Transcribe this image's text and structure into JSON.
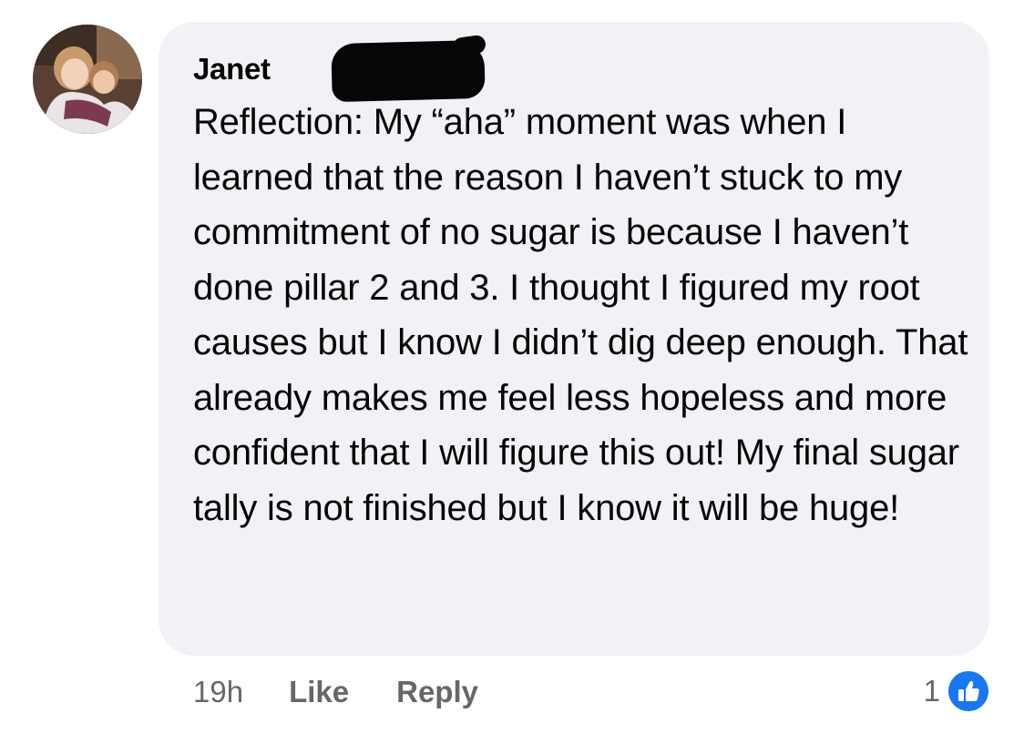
{
  "comment": {
    "author_name": "Janet",
    "text": "Reflection: My “aha” moment was when I learned that the reason I haven’t stuck to my commitment of no sugar is because I haven’t done pillar 2 and 3. I thought I figured my root causes but I know I didn’t dig deep enough. That already makes me feel less hopeless and more confident that I will figure this out! My final sugar tally is not finished but I know it will be huge!",
    "timestamp": "19h",
    "like_label": "Like",
    "reply_label": "Reply",
    "reaction_count": "1"
  },
  "icons": {
    "reaction": "like-thumbs-up-icon"
  },
  "colors": {
    "bubble_background": "#f0f2f5",
    "meta_text": "#65676b",
    "like_blue": "#1877f2",
    "redaction": "#060606"
  }
}
